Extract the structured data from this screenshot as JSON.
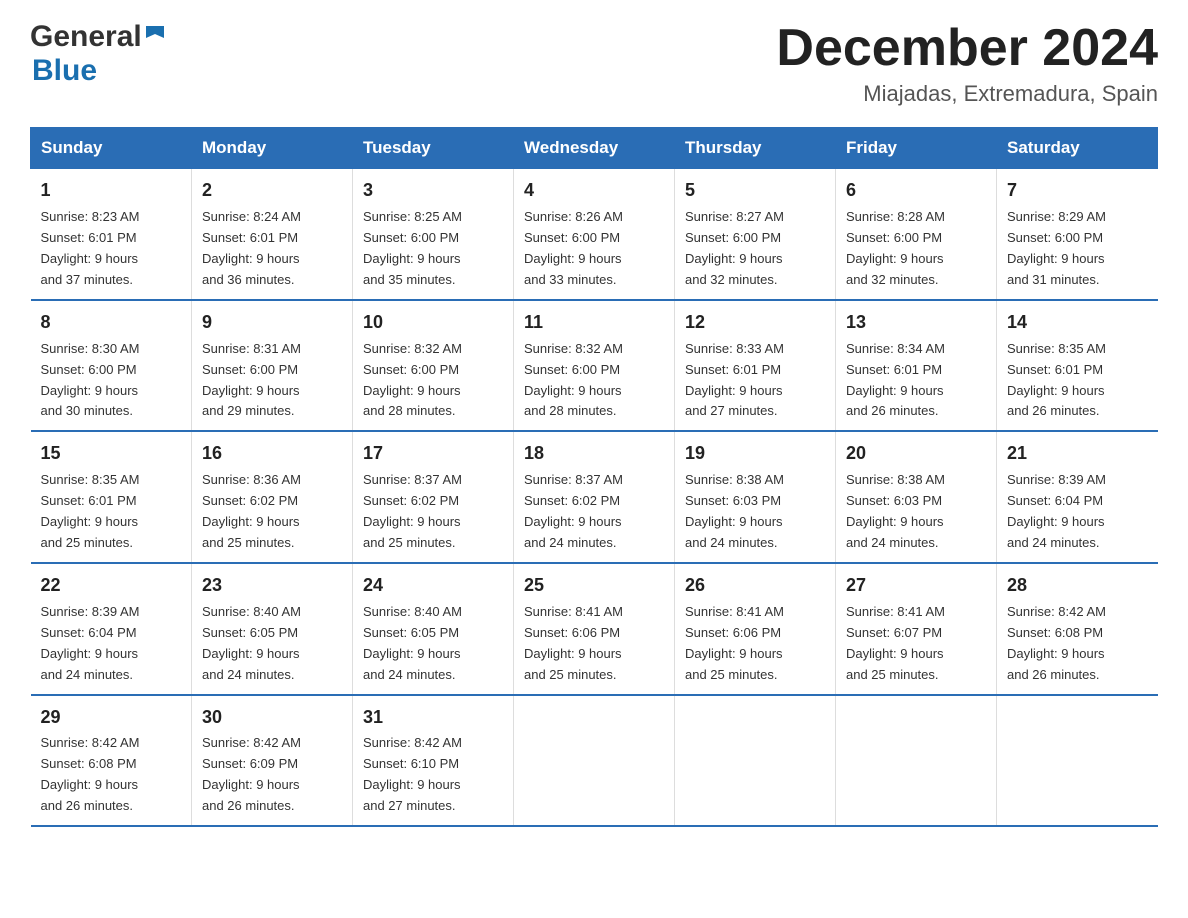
{
  "header": {
    "logo_general": "General",
    "logo_blue": "Blue",
    "month_title": "December 2024",
    "location": "Miajadas, Extremadura, Spain"
  },
  "days_of_week": [
    "Sunday",
    "Monday",
    "Tuesday",
    "Wednesday",
    "Thursday",
    "Friday",
    "Saturday"
  ],
  "weeks": [
    [
      {
        "day": "1",
        "sunrise": "8:23 AM",
        "sunset": "6:01 PM",
        "daylight": "9 hours and 37 minutes."
      },
      {
        "day": "2",
        "sunrise": "8:24 AM",
        "sunset": "6:01 PM",
        "daylight": "9 hours and 36 minutes."
      },
      {
        "day": "3",
        "sunrise": "8:25 AM",
        "sunset": "6:00 PM",
        "daylight": "9 hours and 35 minutes."
      },
      {
        "day": "4",
        "sunrise": "8:26 AM",
        "sunset": "6:00 PM",
        "daylight": "9 hours and 33 minutes."
      },
      {
        "day": "5",
        "sunrise": "8:27 AM",
        "sunset": "6:00 PM",
        "daylight": "9 hours and 32 minutes."
      },
      {
        "day": "6",
        "sunrise": "8:28 AM",
        "sunset": "6:00 PM",
        "daylight": "9 hours and 32 minutes."
      },
      {
        "day": "7",
        "sunrise": "8:29 AM",
        "sunset": "6:00 PM",
        "daylight": "9 hours and 31 minutes."
      }
    ],
    [
      {
        "day": "8",
        "sunrise": "8:30 AM",
        "sunset": "6:00 PM",
        "daylight": "9 hours and 30 minutes."
      },
      {
        "day": "9",
        "sunrise": "8:31 AM",
        "sunset": "6:00 PM",
        "daylight": "9 hours and 29 minutes."
      },
      {
        "day": "10",
        "sunrise": "8:32 AM",
        "sunset": "6:00 PM",
        "daylight": "9 hours and 28 minutes."
      },
      {
        "day": "11",
        "sunrise": "8:32 AM",
        "sunset": "6:00 PM",
        "daylight": "9 hours and 28 minutes."
      },
      {
        "day": "12",
        "sunrise": "8:33 AM",
        "sunset": "6:01 PM",
        "daylight": "9 hours and 27 minutes."
      },
      {
        "day": "13",
        "sunrise": "8:34 AM",
        "sunset": "6:01 PM",
        "daylight": "9 hours and 26 minutes."
      },
      {
        "day": "14",
        "sunrise": "8:35 AM",
        "sunset": "6:01 PM",
        "daylight": "9 hours and 26 minutes."
      }
    ],
    [
      {
        "day": "15",
        "sunrise": "8:35 AM",
        "sunset": "6:01 PM",
        "daylight": "9 hours and 25 minutes."
      },
      {
        "day": "16",
        "sunrise": "8:36 AM",
        "sunset": "6:02 PM",
        "daylight": "9 hours and 25 minutes."
      },
      {
        "day": "17",
        "sunrise": "8:37 AM",
        "sunset": "6:02 PM",
        "daylight": "9 hours and 25 minutes."
      },
      {
        "day": "18",
        "sunrise": "8:37 AM",
        "sunset": "6:02 PM",
        "daylight": "9 hours and 24 minutes."
      },
      {
        "day": "19",
        "sunrise": "8:38 AM",
        "sunset": "6:03 PM",
        "daylight": "9 hours and 24 minutes."
      },
      {
        "day": "20",
        "sunrise": "8:38 AM",
        "sunset": "6:03 PM",
        "daylight": "9 hours and 24 minutes."
      },
      {
        "day": "21",
        "sunrise": "8:39 AM",
        "sunset": "6:04 PM",
        "daylight": "9 hours and 24 minutes."
      }
    ],
    [
      {
        "day": "22",
        "sunrise": "8:39 AM",
        "sunset": "6:04 PM",
        "daylight": "9 hours and 24 minutes."
      },
      {
        "day": "23",
        "sunrise": "8:40 AM",
        "sunset": "6:05 PM",
        "daylight": "9 hours and 24 minutes."
      },
      {
        "day": "24",
        "sunrise": "8:40 AM",
        "sunset": "6:05 PM",
        "daylight": "9 hours and 24 minutes."
      },
      {
        "day": "25",
        "sunrise": "8:41 AM",
        "sunset": "6:06 PM",
        "daylight": "9 hours and 25 minutes."
      },
      {
        "day": "26",
        "sunrise": "8:41 AM",
        "sunset": "6:06 PM",
        "daylight": "9 hours and 25 minutes."
      },
      {
        "day": "27",
        "sunrise": "8:41 AM",
        "sunset": "6:07 PM",
        "daylight": "9 hours and 25 minutes."
      },
      {
        "day": "28",
        "sunrise": "8:42 AM",
        "sunset": "6:08 PM",
        "daylight": "9 hours and 26 minutes."
      }
    ],
    [
      {
        "day": "29",
        "sunrise": "8:42 AM",
        "sunset": "6:08 PM",
        "daylight": "9 hours and 26 minutes."
      },
      {
        "day": "30",
        "sunrise": "8:42 AM",
        "sunset": "6:09 PM",
        "daylight": "9 hours and 26 minutes."
      },
      {
        "day": "31",
        "sunrise": "8:42 AM",
        "sunset": "6:10 PM",
        "daylight": "9 hours and 27 minutes."
      },
      null,
      null,
      null,
      null
    ]
  ],
  "labels": {
    "sunrise": "Sunrise:",
    "sunset": "Sunset:",
    "daylight": "Daylight:"
  }
}
